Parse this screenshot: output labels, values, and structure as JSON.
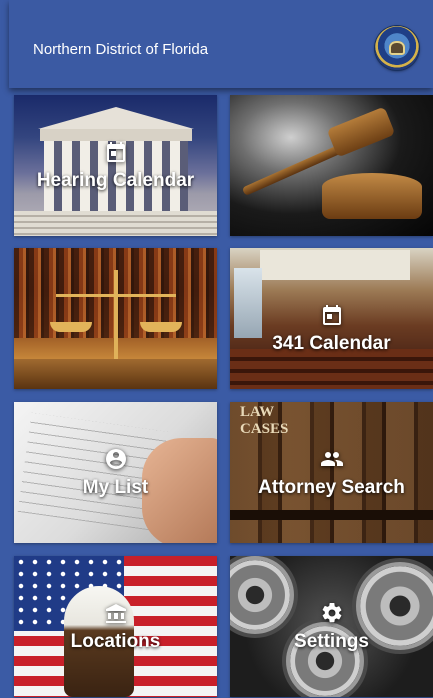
{
  "header": {
    "title": "Northern District of Florida",
    "seal_icon": "court-seal-icon"
  },
  "tiles": [
    {
      "label": "Hearing Calendar",
      "icon": "calendar-icon",
      "background": "courthouse-columns-photo"
    },
    {
      "label": "",
      "icon": "",
      "background": "gavel-photo"
    },
    {
      "label": "",
      "icon": "",
      "background": "scales-of-justice-photo"
    },
    {
      "label": "341 Calendar",
      "icon": "calendar-icon",
      "background": "courtroom-photo"
    },
    {
      "label": "My List",
      "icon": "account-circle-icon",
      "background": "signing-document-photo"
    },
    {
      "label": "Attorney Search",
      "icon": "people-icon",
      "background": "law-books-photo"
    },
    {
      "label": "Locations",
      "icon": "building-icon",
      "background": "eagle-and-flag-photo"
    },
    {
      "label": "Settings",
      "icon": "gear-icon",
      "background": "machine-gears-photo"
    }
  ],
  "law_book_text": "LAW\nCASES",
  "colors": {
    "header": "#3b5aa3",
    "background": "#3b5ba5",
    "tile_text": "#ffffff"
  }
}
